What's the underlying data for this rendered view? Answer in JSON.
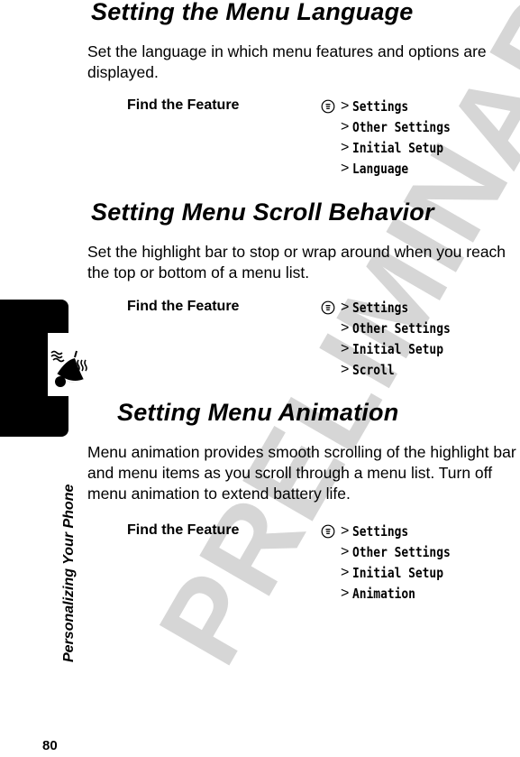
{
  "page": {
    "number": "80",
    "chapter_title": "Personalizing Your Phone",
    "watermark": "PRELIMINARY",
    "tab_icon": "ringer-bell-icon"
  },
  "sections": [
    {
      "title": "Setting the Menu Language",
      "body": "Set the language in which menu features and options are displayed.",
      "find_feature_label": "Find the Feature",
      "menu_icon": "menu-key-icon",
      "path_separator": ">",
      "path": [
        "Settings",
        "Other Settings",
        "Initial Setup",
        "Language"
      ]
    },
    {
      "title": "Setting Menu Scroll Behavior",
      "body": "Set the highlight bar to stop or wrap around when you reach the top or bottom of a menu list.",
      "find_feature_label": "Find the Feature",
      "menu_icon": "menu-key-icon",
      "path_separator": ">",
      "path": [
        "Settings",
        "Other Settings",
        "Initial Setup",
        "Scroll"
      ]
    },
    {
      "title": "Setting Menu Animation",
      "body": "Menu animation provides smooth scrolling of the highlight bar and menu items as you scroll through a menu list. Turn off menu animation to extend battery life.",
      "find_feature_label": "Find the Feature",
      "menu_icon": "menu-key-icon",
      "path_separator": ">",
      "path": [
        "Settings",
        "Other Settings",
        "Initial Setup",
        "Animation"
      ]
    }
  ]
}
